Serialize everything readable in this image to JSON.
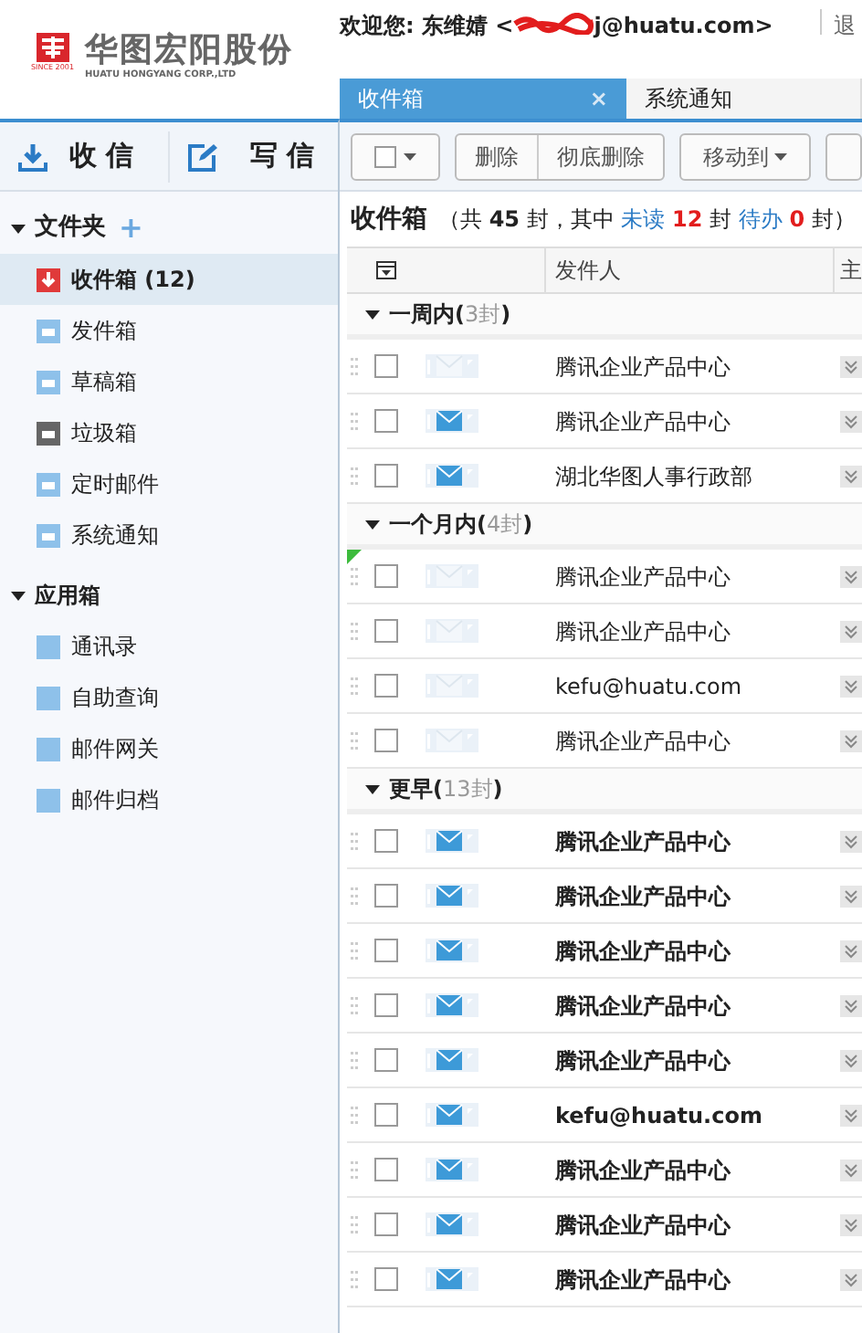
{
  "header": {
    "logo_name": "华图宏阳股份",
    "logo_subtitle": "HUATU HONGYANG CORP.,LTD",
    "logo_since": "SINCE 2001",
    "welcome": "欢迎您: 东维婧 <",
    "email_tail": "j@huatu.com>",
    "logout": "退"
  },
  "tabs": [
    {
      "label": "收件箱",
      "selected": true,
      "close": "×"
    },
    {
      "label": "系统通知",
      "selected": false
    }
  ],
  "sidebar": {
    "receive": "收 信",
    "compose": "写 信",
    "folder_header": "文件夹",
    "add": "+",
    "folders": [
      {
        "label": "收件箱",
        "count": "(12)",
        "kind": "inbox",
        "selected": true
      },
      {
        "label": "发件箱",
        "kind": "folder",
        "selected": false
      },
      {
        "label": "草稿箱",
        "kind": "folder",
        "selected": false
      },
      {
        "label": "垃圾箱",
        "kind": "trash",
        "selected": false
      },
      {
        "label": "定时邮件",
        "kind": "folder",
        "selected": false
      },
      {
        "label": "系统通知",
        "kind": "folder",
        "selected": false
      }
    ],
    "apps_header": "应用箱",
    "apps": [
      {
        "label": "通讯录"
      },
      {
        "label": "自助查询"
      },
      {
        "label": "邮件网关"
      },
      {
        "label": "邮件归档"
      }
    ]
  },
  "toolbar": {
    "buttons": [
      "删除",
      "彻底删除"
    ],
    "move": "移动到"
  },
  "summary": {
    "title": "收件箱",
    "parts": [
      "（共",
      "45",
      "封，其中",
      "未读",
      "12",
      "封",
      "待办",
      "0",
      "封）"
    ]
  },
  "table": {
    "columns": [
      "发件人",
      "主"
    ],
    "groups": [
      {
        "label": "一周内(",
        "count": "3封",
        "close": ")",
        "rows": [
          {
            "sender": "腾讯企业产品中心",
            "unread": false,
            "bold": false,
            "flag": false,
            "checked": false
          },
          {
            "sender": "腾讯企业产品中心",
            "unread": true,
            "bold": false,
            "flag": false,
            "checked": false
          },
          {
            "sender": "湖北华图人事行政部",
            "unread": true,
            "bold": false,
            "flag": false,
            "checked": false
          }
        ]
      },
      {
        "label": "一个月内(",
        "count": "4封",
        "close": ")",
        "rows": [
          {
            "sender": "腾讯企业产品中心",
            "unread": false,
            "bold": false,
            "flag": true,
            "checked": false
          },
          {
            "sender": "腾讯企业产品中心",
            "unread": false,
            "bold": false,
            "flag": false,
            "checked": false
          },
          {
            "sender": "kefu@huatu.com",
            "unread": false,
            "bold": false,
            "flag": false,
            "checked": false
          },
          {
            "sender": "腾讯企业产品中心",
            "unread": false,
            "bold": false,
            "flag": false,
            "checked": false
          }
        ]
      },
      {
        "label": "更早(",
        "count": "13封",
        "close": ")",
        "rows": [
          {
            "sender": "腾讯企业产品中心",
            "unread": true,
            "bold": true,
            "flag": false,
            "checked": false
          },
          {
            "sender": "腾讯企业产品中心",
            "unread": true,
            "bold": true,
            "flag": false,
            "checked": false
          },
          {
            "sender": "腾讯企业产品中心",
            "unread": true,
            "bold": true,
            "flag": false,
            "checked": false
          },
          {
            "sender": "腾讯企业产品中心",
            "unread": true,
            "bold": true,
            "flag": false,
            "checked": false
          },
          {
            "sender": "腾讯企业产品中心",
            "unread": true,
            "bold": true,
            "flag": false,
            "checked": false
          },
          {
            "sender": "kefu@huatu.com",
            "unread": true,
            "bold": true,
            "flag": false,
            "checked": false
          },
          {
            "sender": "腾讯企业产品中心",
            "unread": true,
            "bold": true,
            "flag": false,
            "checked": false
          },
          {
            "sender": "腾讯企业产品中心",
            "unread": true,
            "bold": true,
            "flag": false,
            "checked": false
          },
          {
            "sender": "腾讯企业产品中心",
            "unread": true,
            "bold": true,
            "flag": false,
            "checked": false
          }
        ]
      }
    ]
  }
}
